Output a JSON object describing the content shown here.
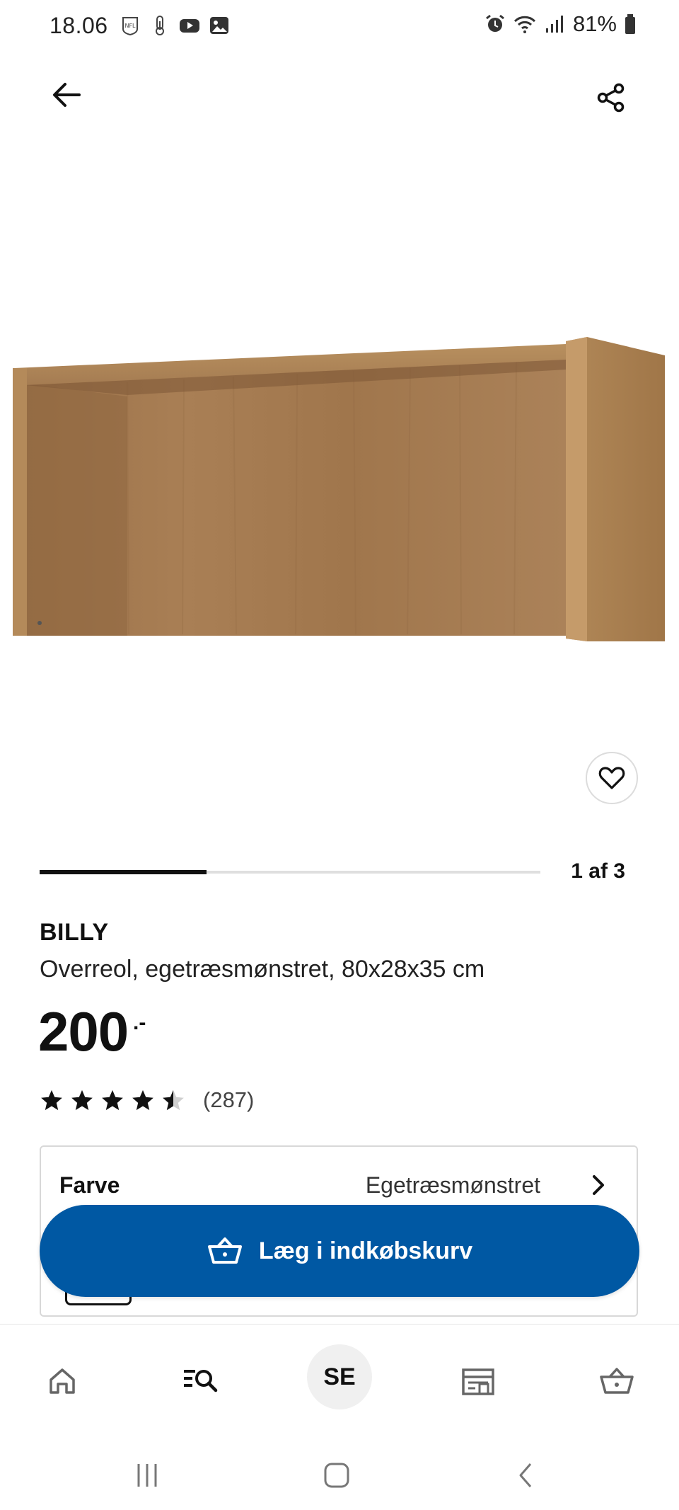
{
  "status_bar": {
    "time": "18.06",
    "battery": "81%",
    "left_icons": [
      "nfl-icon",
      "thermometer-icon",
      "youtube-icon",
      "gallery-icon"
    ],
    "right_icons": [
      "alarm-icon",
      "wifi-icon",
      "signal-icon",
      "battery-icon"
    ]
  },
  "header": {
    "back_icon": "arrow-left-icon",
    "share_icon": "share-icon"
  },
  "gallery": {
    "counter": "1 af 3",
    "current": 1,
    "total": 3
  },
  "product": {
    "name": "BILLY",
    "description": "Overreol, egetræsmønstret, 80x28x35 cm",
    "price": "200",
    "price_suffix": ".-",
    "rating": 4.5,
    "rating_max": 5,
    "review_count": "(287)"
  },
  "color_option": {
    "label": "Farve",
    "value": "Egetræsmønstret"
  },
  "cart_button": {
    "label": "Læg i indkøbskurv"
  },
  "bottom_nav": {
    "items": [
      "home-icon",
      "search-icon",
      "store-selector",
      "store-icon",
      "basket-icon"
    ],
    "store_code": "SE"
  },
  "colors": {
    "accent_blue": "#0058a3",
    "text": "#111111",
    "wood": "#a57c52"
  }
}
